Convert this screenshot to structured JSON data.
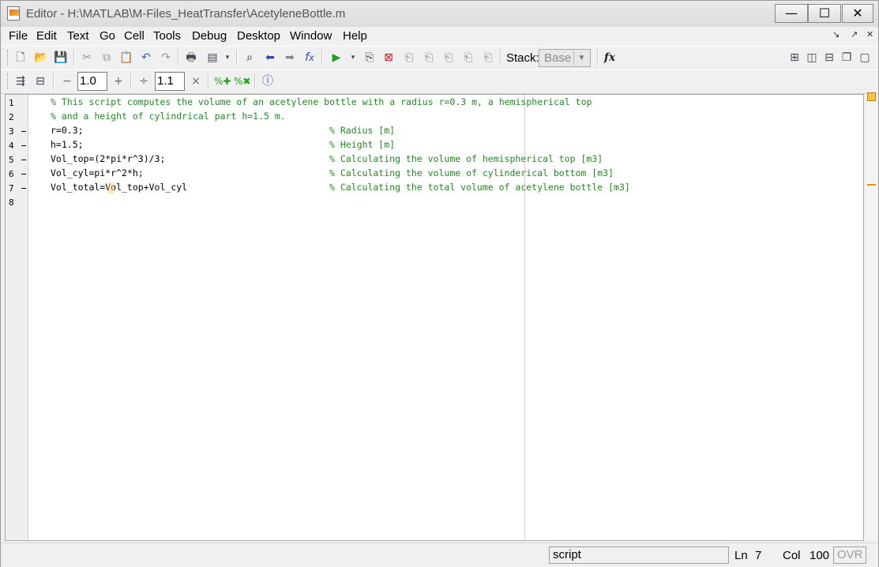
{
  "window": {
    "title": "Editor - H:\\MATLAB\\M-Files_HeatTransfer\\AcetyleneBottle.m",
    "minimize": "—",
    "maximize": "☐",
    "close": "✕"
  },
  "menu": {
    "items": [
      "File",
      "Edit",
      "Text",
      "Go",
      "Cell",
      "Tools",
      "Debug",
      "Desktop",
      "Window",
      "Help"
    ]
  },
  "toolbar": {
    "stack_label": "Stack:",
    "stack_value": "Base",
    "fx_label": "fx"
  },
  "cell_toolbar": {
    "minus": "−",
    "plus": "+",
    "divide": "÷",
    "times": "×",
    "increment_value": "1.0",
    "divide_value": "1.1"
  },
  "editor": {
    "lines": [
      {
        "num": "1",
        "breakpoint": false,
        "code": "",
        "comment": "% This script computes the volume of an acetylene bottle with a radius r=0.3 m, a hemispherical top"
      },
      {
        "num": "2",
        "breakpoint": false,
        "code": "",
        "comment": "% and a height of cylindrical part h=1.5 m."
      },
      {
        "num": "3",
        "breakpoint": true,
        "code": "r=0.3;",
        "comment": "% Radius [m]"
      },
      {
        "num": "4",
        "breakpoint": true,
        "code": "h=1.5;",
        "comment": "% Height [m]"
      },
      {
        "num": "5",
        "breakpoint": true,
        "code": "Vol_top=(2*pi*r^3)/3;",
        "comment": "% Calculating the volume of hemispherical top [m3]"
      },
      {
        "num": "6",
        "breakpoint": true,
        "code": "Vol_cyl=pi*r^2*h;",
        "comment": "% Calculating the volume of cylinderical bottom [m3]"
      },
      {
        "num": "7",
        "breakpoint": true,
        "code": "Vol_total=Vol_top+Vol_cyl",
        "comment": "% Calculating the total volume of acetylene bottle [m3]"
      },
      {
        "num": "8",
        "breakpoint": false,
        "code": "",
        "comment": ""
      }
    ]
  },
  "status": {
    "mode": "script",
    "ln_label": "Ln",
    "ln_value": "7",
    "col_label": "Col",
    "col_value": "100",
    "ovr": "OVR"
  }
}
